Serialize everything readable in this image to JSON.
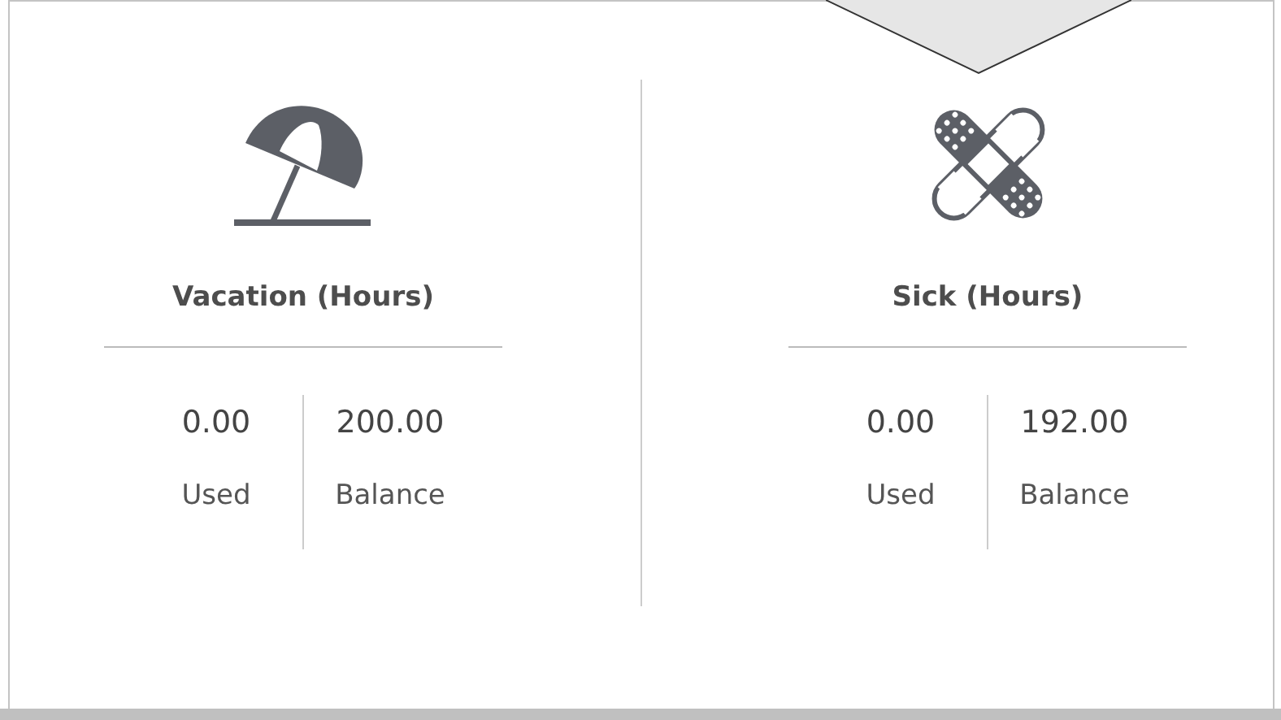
{
  "categories": [
    {
      "kind": "vacation",
      "title": "Vacation (Hours)",
      "used": "0.00",
      "used_label": "Used",
      "balance": "200.00",
      "balance_label": "Balance"
    },
    {
      "kind": "sick",
      "title": "Sick (Hours)",
      "used": "0.00",
      "used_label": "Used",
      "balance": "192.00",
      "balance_label": "Balance"
    }
  ]
}
